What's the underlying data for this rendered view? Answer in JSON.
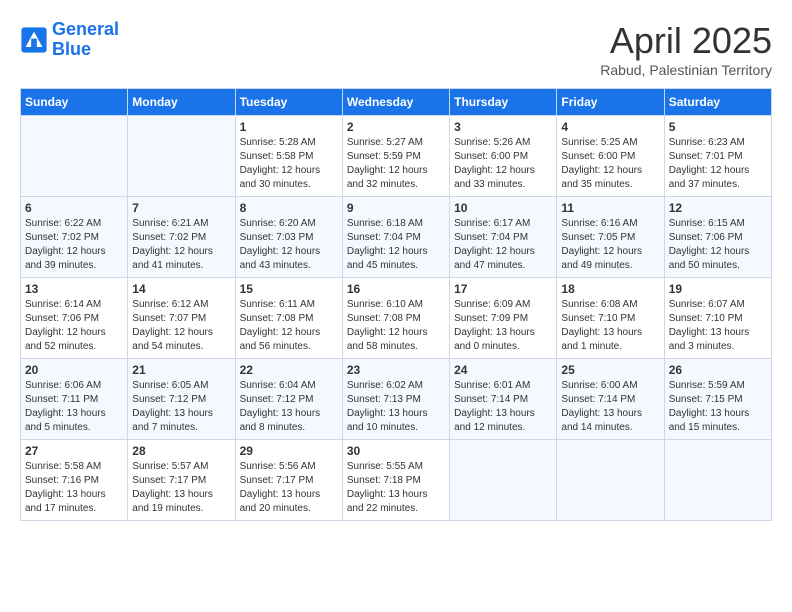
{
  "logo": {
    "line1": "General",
    "line2": "Blue"
  },
  "title": "April 2025",
  "subtitle": "Rabud, Palestinian Territory",
  "days_header": [
    "Sunday",
    "Monday",
    "Tuesday",
    "Wednesday",
    "Thursday",
    "Friday",
    "Saturday"
  ],
  "weeks": [
    [
      {
        "day": "",
        "info": ""
      },
      {
        "day": "",
        "info": ""
      },
      {
        "day": "1",
        "info": "Sunrise: 5:28 AM\nSunset: 5:58 PM\nDaylight: 12 hours\nand 30 minutes."
      },
      {
        "day": "2",
        "info": "Sunrise: 5:27 AM\nSunset: 5:59 PM\nDaylight: 12 hours\nand 32 minutes."
      },
      {
        "day": "3",
        "info": "Sunrise: 5:26 AM\nSunset: 6:00 PM\nDaylight: 12 hours\nand 33 minutes."
      },
      {
        "day": "4",
        "info": "Sunrise: 5:25 AM\nSunset: 6:00 PM\nDaylight: 12 hours\nand 35 minutes."
      },
      {
        "day": "5",
        "info": "Sunrise: 6:23 AM\nSunset: 7:01 PM\nDaylight: 12 hours\nand 37 minutes."
      }
    ],
    [
      {
        "day": "6",
        "info": "Sunrise: 6:22 AM\nSunset: 7:02 PM\nDaylight: 12 hours\nand 39 minutes."
      },
      {
        "day": "7",
        "info": "Sunrise: 6:21 AM\nSunset: 7:02 PM\nDaylight: 12 hours\nand 41 minutes."
      },
      {
        "day": "8",
        "info": "Sunrise: 6:20 AM\nSunset: 7:03 PM\nDaylight: 12 hours\nand 43 minutes."
      },
      {
        "day": "9",
        "info": "Sunrise: 6:18 AM\nSunset: 7:04 PM\nDaylight: 12 hours\nand 45 minutes."
      },
      {
        "day": "10",
        "info": "Sunrise: 6:17 AM\nSunset: 7:04 PM\nDaylight: 12 hours\nand 47 minutes."
      },
      {
        "day": "11",
        "info": "Sunrise: 6:16 AM\nSunset: 7:05 PM\nDaylight: 12 hours\nand 49 minutes."
      },
      {
        "day": "12",
        "info": "Sunrise: 6:15 AM\nSunset: 7:06 PM\nDaylight: 12 hours\nand 50 minutes."
      }
    ],
    [
      {
        "day": "13",
        "info": "Sunrise: 6:14 AM\nSunset: 7:06 PM\nDaylight: 12 hours\nand 52 minutes."
      },
      {
        "day": "14",
        "info": "Sunrise: 6:12 AM\nSunset: 7:07 PM\nDaylight: 12 hours\nand 54 minutes."
      },
      {
        "day": "15",
        "info": "Sunrise: 6:11 AM\nSunset: 7:08 PM\nDaylight: 12 hours\nand 56 minutes."
      },
      {
        "day": "16",
        "info": "Sunrise: 6:10 AM\nSunset: 7:08 PM\nDaylight: 12 hours\nand 58 minutes."
      },
      {
        "day": "17",
        "info": "Sunrise: 6:09 AM\nSunset: 7:09 PM\nDaylight: 13 hours\nand 0 minutes."
      },
      {
        "day": "18",
        "info": "Sunrise: 6:08 AM\nSunset: 7:10 PM\nDaylight: 13 hours\nand 1 minute."
      },
      {
        "day": "19",
        "info": "Sunrise: 6:07 AM\nSunset: 7:10 PM\nDaylight: 13 hours\nand 3 minutes."
      }
    ],
    [
      {
        "day": "20",
        "info": "Sunrise: 6:06 AM\nSunset: 7:11 PM\nDaylight: 13 hours\nand 5 minutes."
      },
      {
        "day": "21",
        "info": "Sunrise: 6:05 AM\nSunset: 7:12 PM\nDaylight: 13 hours\nand 7 minutes."
      },
      {
        "day": "22",
        "info": "Sunrise: 6:04 AM\nSunset: 7:12 PM\nDaylight: 13 hours\nand 8 minutes."
      },
      {
        "day": "23",
        "info": "Sunrise: 6:02 AM\nSunset: 7:13 PM\nDaylight: 13 hours\nand 10 minutes."
      },
      {
        "day": "24",
        "info": "Sunrise: 6:01 AM\nSunset: 7:14 PM\nDaylight: 13 hours\nand 12 minutes."
      },
      {
        "day": "25",
        "info": "Sunrise: 6:00 AM\nSunset: 7:14 PM\nDaylight: 13 hours\nand 14 minutes."
      },
      {
        "day": "26",
        "info": "Sunrise: 5:59 AM\nSunset: 7:15 PM\nDaylight: 13 hours\nand 15 minutes."
      }
    ],
    [
      {
        "day": "27",
        "info": "Sunrise: 5:58 AM\nSunset: 7:16 PM\nDaylight: 13 hours\nand 17 minutes."
      },
      {
        "day": "28",
        "info": "Sunrise: 5:57 AM\nSunset: 7:17 PM\nDaylight: 13 hours\nand 19 minutes."
      },
      {
        "day": "29",
        "info": "Sunrise: 5:56 AM\nSunset: 7:17 PM\nDaylight: 13 hours\nand 20 minutes."
      },
      {
        "day": "30",
        "info": "Sunrise: 5:55 AM\nSunset: 7:18 PM\nDaylight: 13 hours\nand 22 minutes."
      },
      {
        "day": "",
        "info": ""
      },
      {
        "day": "",
        "info": ""
      },
      {
        "day": "",
        "info": ""
      }
    ]
  ]
}
